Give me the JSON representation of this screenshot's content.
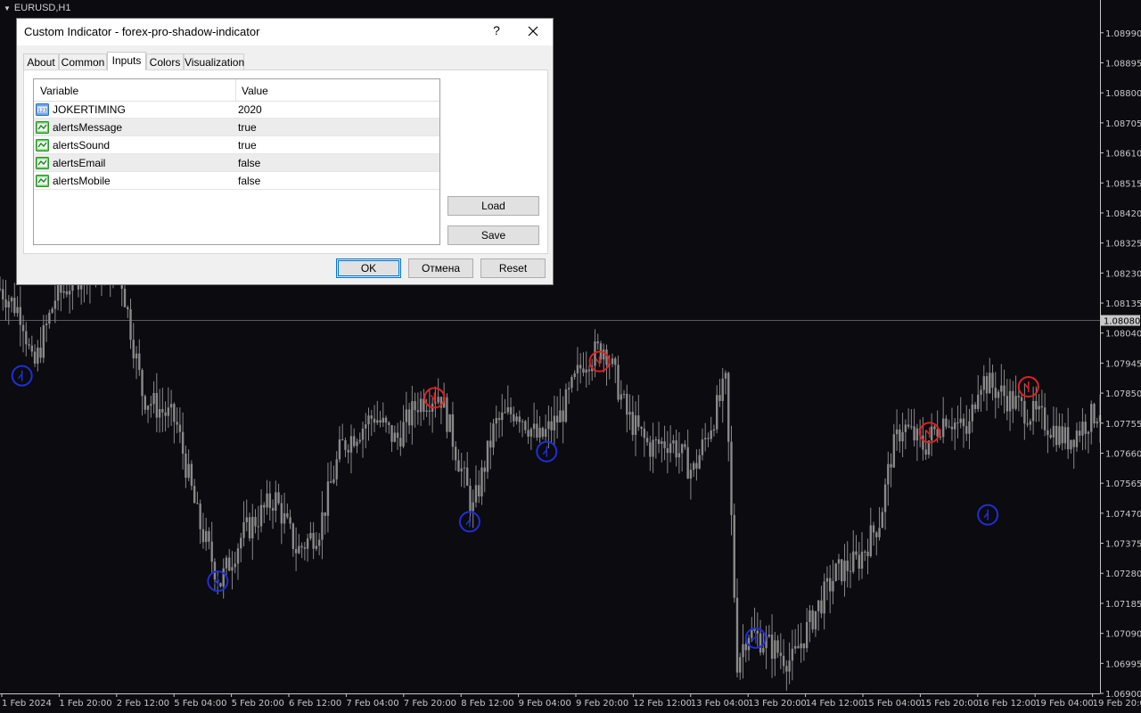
{
  "window": {
    "title": "EURUSD,H1"
  },
  "chart_data": {
    "type": "candlestick",
    "symbol": "EURUSD",
    "timeframe": "H1",
    "price_ticks": [
      "1.08990",
      "1.08895",
      "1.08800",
      "1.08705",
      "1.08610",
      "1.08515",
      "1.08420",
      "1.08325",
      "1.08230",
      "1.08135",
      "1.08040",
      "1.07945",
      "1.07850",
      "1.07755",
      "1.07660",
      "1.07565",
      "1.07470",
      "1.07375",
      "1.07280",
      "1.07185",
      "1.07090",
      "1.06995",
      "1.06900"
    ],
    "ylim": [
      1.069,
      1.09043
    ],
    "current_price": "1.08080",
    "time_labels": [
      "1 Feb 2024",
      "1 Feb 20:00",
      "2 Feb 12:00",
      "5 Feb 04:00",
      "5 Feb 20:00",
      "6 Feb 12:00",
      "7 Feb 04:00",
      "7 Feb 20:00",
      "8 Feb 12:00",
      "9 Feb 04:00",
      "9 Feb 20:00",
      "12 Feb 12:00",
      "13 Feb 04:00",
      "13 Feb 20:00",
      "14 Feb 12:00",
      "15 Feb 04:00",
      "15 Feb 20:00",
      "16 Feb 12:00",
      "19 Feb 04:00",
      "19 Feb 20:00"
    ],
    "price_path": [
      [
        0,
        1.0818
      ],
      [
        0.02,
        1.081
      ],
      [
        0.03,
        1.0792
      ],
      [
        0.05,
        1.0815
      ],
      [
        0.08,
        1.0825
      ],
      [
        0.11,
        1.0822
      ],
      [
        0.13,
        1.0784
      ],
      [
        0.16,
        1.0776
      ],
      [
        0.18,
        1.0745
      ],
      [
        0.2,
        1.0725
      ],
      [
        0.22,
        1.074
      ],
      [
        0.25,
        1.0752
      ],
      [
        0.27,
        1.0735
      ],
      [
        0.29,
        1.0742
      ],
      [
        0.31,
        1.0768
      ],
      [
        0.34,
        1.0778
      ],
      [
        0.36,
        1.077
      ],
      [
        0.38,
        1.0782
      ],
      [
        0.4,
        1.0785
      ],
      [
        0.42,
        1.076
      ],
      [
        0.43,
        1.0748
      ],
      [
        0.45,
        1.0775
      ],
      [
        0.47,
        1.078
      ],
      [
        0.49,
        1.077
      ],
      [
        0.51,
        1.0778
      ],
      [
        0.53,
        1.0795
      ],
      [
        0.55,
        1.08
      ],
      [
        0.57,
        1.0778
      ],
      [
        0.59,
        1.0768
      ],
      [
        0.61,
        1.077
      ],
      [
        0.63,
        1.076
      ],
      [
        0.66,
        1.0788
      ],
      [
        0.67,
        1.07
      ],
      [
        0.68,
        1.071
      ],
      [
        0.7,
        1.0705
      ],
      [
        0.72,
        1.07
      ],
      [
        0.74,
        1.0715
      ],
      [
        0.76,
        1.0728
      ],
      [
        0.78,
        1.0732
      ],
      [
        0.8,
        1.0745
      ],
      [
        0.81,
        1.0765
      ],
      [
        0.82,
        1.0775
      ],
      [
        0.84,
        1.0768
      ],
      [
        0.86,
        1.0778
      ],
      [
        0.88,
        1.0772
      ],
      [
        0.89,
        1.079
      ],
      [
        0.91,
        1.0785
      ],
      [
        0.93,
        1.078
      ],
      [
        0.95,
        1.0776
      ],
      [
        0.97,
        1.077
      ],
      [
        1.0,
        1.078
      ]
    ],
    "signals": [
      {
        "type": "sell",
        "t": 0.395,
        "price": 1.07835
      },
      {
        "type": "sell",
        "t": 0.545,
        "price": 1.0795
      },
      {
        "type": "sell",
        "t": 0.845,
        "price": 1.07725
      },
      {
        "type": "sell",
        "t": 0.935,
        "price": 1.0787
      },
      {
        "type": "buy",
        "t": 0.02,
        "price": 1.07905
      },
      {
        "type": "buy",
        "t": 0.198,
        "price": 1.07255
      },
      {
        "type": "buy",
        "t": 0.427,
        "price": 1.07443
      },
      {
        "type": "buy",
        "t": 0.497,
        "price": 1.07665
      },
      {
        "type": "buy",
        "t": 0.687,
        "price": 1.07075
      },
      {
        "type": "buy",
        "t": 0.898,
        "price": 1.07465
      }
    ],
    "colors": {
      "background": "#0b0b10",
      "candle": "#8a8a8a",
      "buy": "#1f2fd8",
      "sell": "#e02020",
      "axis": "#c8c8c8",
      "current_line": "#5a5a62"
    }
  },
  "dialog": {
    "title": "Custom Indicator - forex-pro-shadow-indicator",
    "help": "?",
    "tabs": [
      "About",
      "Common",
      "Inputs",
      "Colors",
      "Visualization"
    ],
    "active_tab": "Inputs",
    "columns": [
      "Variable",
      "Value"
    ],
    "rows": [
      {
        "variable": "JOKERTIMING",
        "value": "2020",
        "icon": "integer-icon"
      },
      {
        "variable": "alertsMessage",
        "value": "true",
        "icon": "bool-icon"
      },
      {
        "variable": "alertsSound",
        "value": "true",
        "icon": "bool-icon"
      },
      {
        "variable": "alertsEmail",
        "value": "false",
        "icon": "bool-icon"
      },
      {
        "variable": "alertsMobile",
        "value": "false",
        "icon": "bool-icon"
      }
    ],
    "int_icon_text": "123",
    "buttons": {
      "load": "Load",
      "save": "Save",
      "ok": "OK",
      "cancel": "Отмена",
      "reset": "Reset"
    }
  }
}
